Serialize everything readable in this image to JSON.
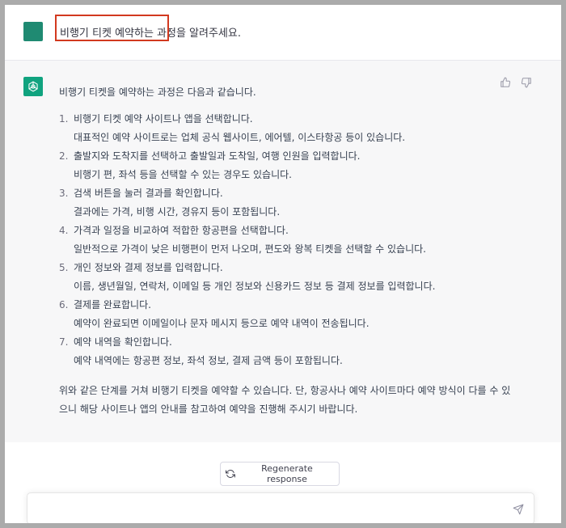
{
  "user_message": {
    "text": "비행기 티켓 예약하는 과정을 알려주세요."
  },
  "assistant_message": {
    "intro": "비행기 티켓을 예약하는 과정은 다음과 같습니다.",
    "steps": [
      {
        "num": "1.",
        "title": "비행기 티켓 예약 사이트나 앱을 선택합니다.",
        "detail": "대표적인 예약 사이트로는 업체 공식 웹사이트, 에어텔, 이스타항공 등이 있습니다."
      },
      {
        "num": "2.",
        "title": "출발지와 도착지를 선택하고 출발일과 도착일, 여행 인원을 입력합니다.",
        "detail": "비행기 편, 좌석 등을 선택할 수 있는 경우도 있습니다."
      },
      {
        "num": "3.",
        "title": "검색 버튼을 눌러 결과를 확인합니다.",
        "detail": "결과에는 가격, 비행 시간, 경유지 등이 포함됩니다."
      },
      {
        "num": "4.",
        "title": "가격과 일정을 비교하여 적합한 항공편을 선택합니다.",
        "detail": "일반적으로 가격이 낮은 비행편이 먼저 나오며, 편도와 왕복 티켓을 선택할 수 있습니다."
      },
      {
        "num": "5.",
        "title": "개인 정보와 결제 정보를 입력합니다.",
        "detail": "이름, 생년월일, 연락처, 이메일 등 개인 정보와 신용카드 정보 등 결제 정보를 입력합니다."
      },
      {
        "num": "6.",
        "title": "결제를 완료합니다.",
        "detail": "예약이 완료되면 이메일이나 문자 메시지 등으로 예약 내역이 전송됩니다."
      },
      {
        "num": "7.",
        "title": "예약 내역을 확인합니다.",
        "detail": "예약 내역에는 항공편 정보, 좌석 정보, 결제 금액 등이 포함됩니다."
      }
    ],
    "outro": "위와 같은 단계를 거쳐 비행기 티켓을 예약할 수 있습니다. 단, 항공사나 예약 사이트마다 예약 방식이 다를 수 있으니 해당 사이트나 앱의 안내를 참고하여 예약을 진행해 주시기 바랍니다."
  },
  "controls": {
    "regenerate_label": "Regenerate response",
    "input_placeholder": ""
  },
  "icons": {
    "thumbs_up": "thumbs-up-icon",
    "thumbs_down": "thumbs-down-icon",
    "regenerate": "refresh-icon",
    "send": "send-icon",
    "assistant_logo": "openai-logo-icon"
  },
  "colors": {
    "user_avatar": "#1f8a72",
    "assistant_avatar": "#10a37f",
    "highlight_border": "#d2391f",
    "assistant_background": "#f7f7f8"
  }
}
